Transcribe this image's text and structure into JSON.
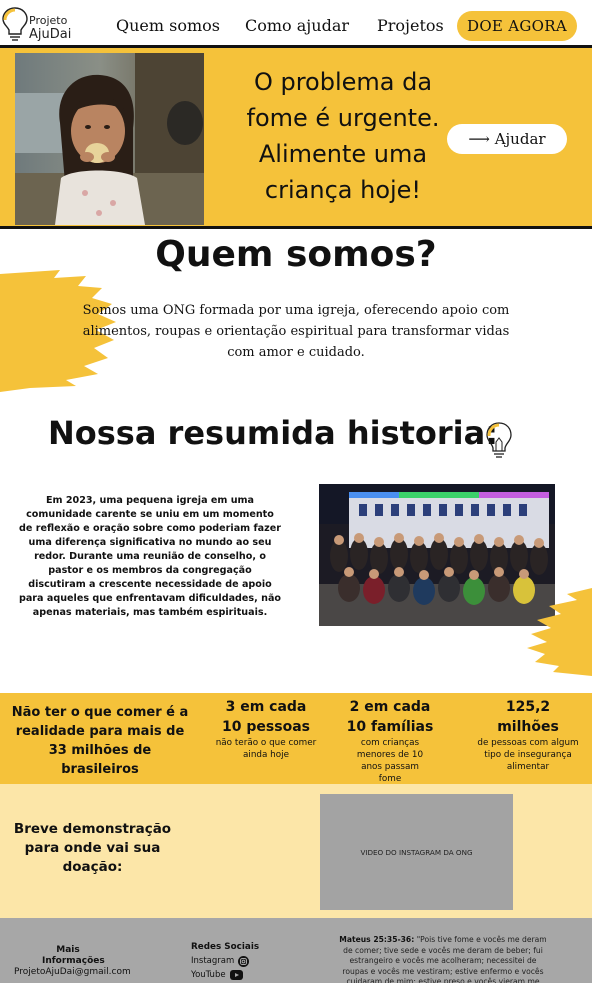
{
  "nav": {
    "logo_line1": "Projeto",
    "logo_line2": "AjuDai",
    "links": [
      "Quem somos",
      "Como ajudar",
      "Projetos"
    ],
    "cta_label": "DOE AGORA"
  },
  "hero": {
    "title": "O problema da fome é urgente. Alimente uma criança hoje!",
    "button_label": "⟶ Ajudar"
  },
  "about": {
    "title": "Quem somos?",
    "text": "Somos uma ONG formada por uma igreja, oferecendo apoio com alimentos, roupas e orientação espiritual para transformar vidas com amor e cuidado."
  },
  "history": {
    "title": "Nossa resumida historia:",
    "text": "Em 2023, uma pequena igreja em uma comunidade carente se uniu em um momento de reflexão e oração sobre como poderiam fazer uma diferença significativa no mundo ao seu redor. Durante uma reunião de conselho, o pastor e os membros da congregação discutiram a crescente necessidade de apoio para aqueles que enfrentavam dificuldades, não apenas materiais, mas também espirituais."
  },
  "stats": [
    {
      "big": "Não ter o que comer é a realidade para mais de 33 milhões de brasileiros",
      "small": ""
    },
    {
      "big": "3 em cada 10 pessoas",
      "small": "não terão o que comer ainda hoje"
    },
    {
      "big": "2 em cada 10 famílias",
      "small": "com crianças menores de 10 anos passam fome"
    },
    {
      "big": "125,2 milhões",
      "small": "de pessoas com algum tipo de insegurança alimentar"
    }
  ],
  "demo": {
    "text": "Breve demonstração para onde vai sua doação:",
    "video_label": "VIDEO DO INSTAGRAM DA ONG"
  },
  "footer": {
    "info_title": "Mais Informações",
    "email": "ProjetoAjuDai@gmail.com",
    "social_title": "Redes Sociais",
    "instagram": "Instagram",
    "youtube": "YouTube",
    "verse_ref": "Mateus 25:35-36:",
    "verse_text": "\"Pois tive fome e vocês me deram de comer; tive sede e vocês me deram de beber; fui estrangeiro e vocês me acolheram; necessitei de roupas e vocês me vestiram; estive enfermo e vocês cuidaram de mim; estive preso e vocês vieram me visitar.\""
  },
  "colors": {
    "accent": "#f5c23a",
    "light_accent": "#fce6a8",
    "footer": "#a7a7a7",
    "text": "#111111"
  },
  "icons": [
    "lightbulb-icon",
    "instagram-icon",
    "youtube-icon",
    "arrow-right-icon"
  ]
}
